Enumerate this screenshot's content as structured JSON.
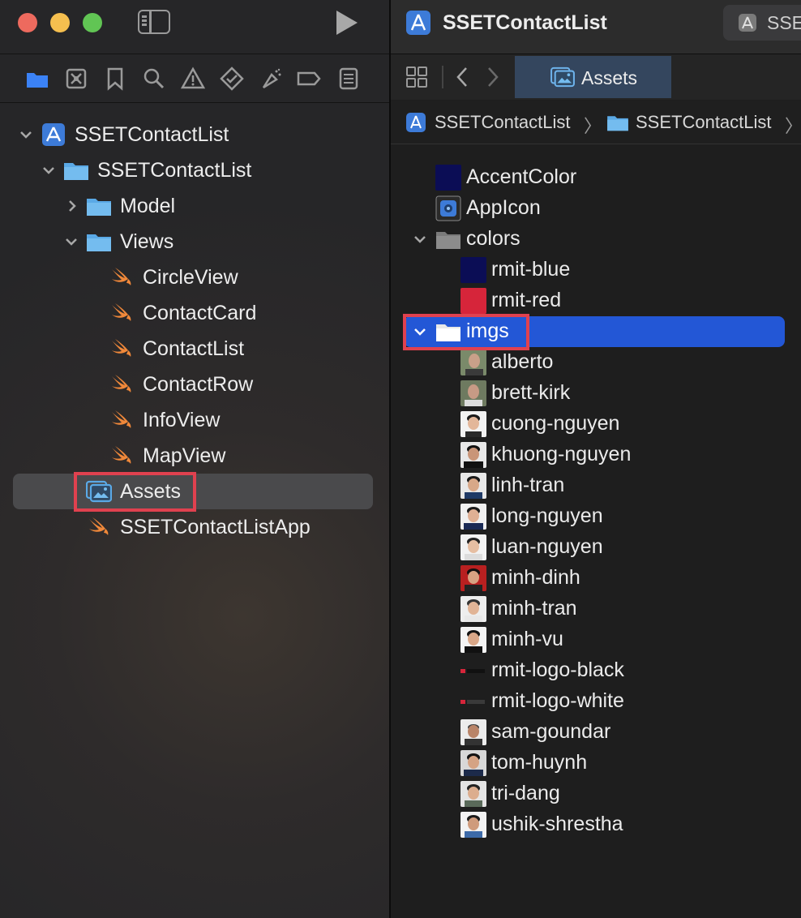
{
  "window": {
    "project_title": "SSETContactList",
    "scheme_label": "SSE"
  },
  "navigator": {
    "tabs": [
      "folder-icon",
      "source-control-icon",
      "bookmark-icon",
      "find-icon",
      "issue-icon",
      "test-icon",
      "debug-icon",
      "breakpoint-icon",
      "report-icon"
    ],
    "tree": [
      {
        "label": "SSETContactList",
        "kind": "project",
        "expanded": true
      },
      {
        "label": "SSETContactList",
        "kind": "folder",
        "expanded": true
      },
      {
        "label": "Model",
        "kind": "folder",
        "expanded": false
      },
      {
        "label": "Views",
        "kind": "folder",
        "expanded": true
      },
      {
        "label": "CircleView",
        "kind": "swift"
      },
      {
        "label": "ContactCard",
        "kind": "swift"
      },
      {
        "label": "ContactList",
        "kind": "swift"
      },
      {
        "label": "ContactRow",
        "kind": "swift"
      },
      {
        "label": "InfoView",
        "kind": "swift"
      },
      {
        "label": "MapView",
        "kind": "swift"
      },
      {
        "label": "Assets",
        "kind": "assets",
        "selected": true
      },
      {
        "label": "SSETContactListApp",
        "kind": "swift"
      }
    ]
  },
  "editor": {
    "active_tab": "Assets",
    "jump_bar": [
      "SSETContactList",
      "SSETContactList"
    ],
    "assets": [
      {
        "label": "AccentColor",
        "kind": "color",
        "color": "#0b0d55"
      },
      {
        "label": "AppIcon",
        "kind": "appicon"
      },
      {
        "label": "colors",
        "kind": "group",
        "expanded": true
      },
      {
        "label": "rmit-blue",
        "kind": "color",
        "color": "#0b0d55"
      },
      {
        "label": "rmit-red",
        "kind": "color",
        "color": "#d6253a"
      },
      {
        "label": "imgs",
        "kind": "group",
        "expanded": true,
        "selected": true
      },
      {
        "label": "alberto",
        "kind": "image"
      },
      {
        "label": "brett-kirk",
        "kind": "image"
      },
      {
        "label": "cuong-nguyen",
        "kind": "image"
      },
      {
        "label": "khuong-nguyen",
        "kind": "image"
      },
      {
        "label": "linh-tran",
        "kind": "image"
      },
      {
        "label": "long-nguyen",
        "kind": "image"
      },
      {
        "label": "luan-nguyen",
        "kind": "image"
      },
      {
        "label": "minh-dinh",
        "kind": "image"
      },
      {
        "label": "minh-tran",
        "kind": "image"
      },
      {
        "label": "minh-vu",
        "kind": "image"
      },
      {
        "label": "rmit-logo-black",
        "kind": "logo"
      },
      {
        "label": "rmit-logo-white",
        "kind": "logo"
      },
      {
        "label": "sam-goundar",
        "kind": "image"
      },
      {
        "label": "tom-huynh",
        "kind": "image"
      },
      {
        "label": "tri-dang",
        "kind": "image"
      },
      {
        "label": "ushik-shrestha",
        "kind": "image"
      }
    ]
  },
  "colors": {
    "selection_blue": "#2357d6",
    "highlight_red": "#e0414f",
    "folder_blue": "#5aa9e6",
    "swift_orange": "#f0883a"
  }
}
